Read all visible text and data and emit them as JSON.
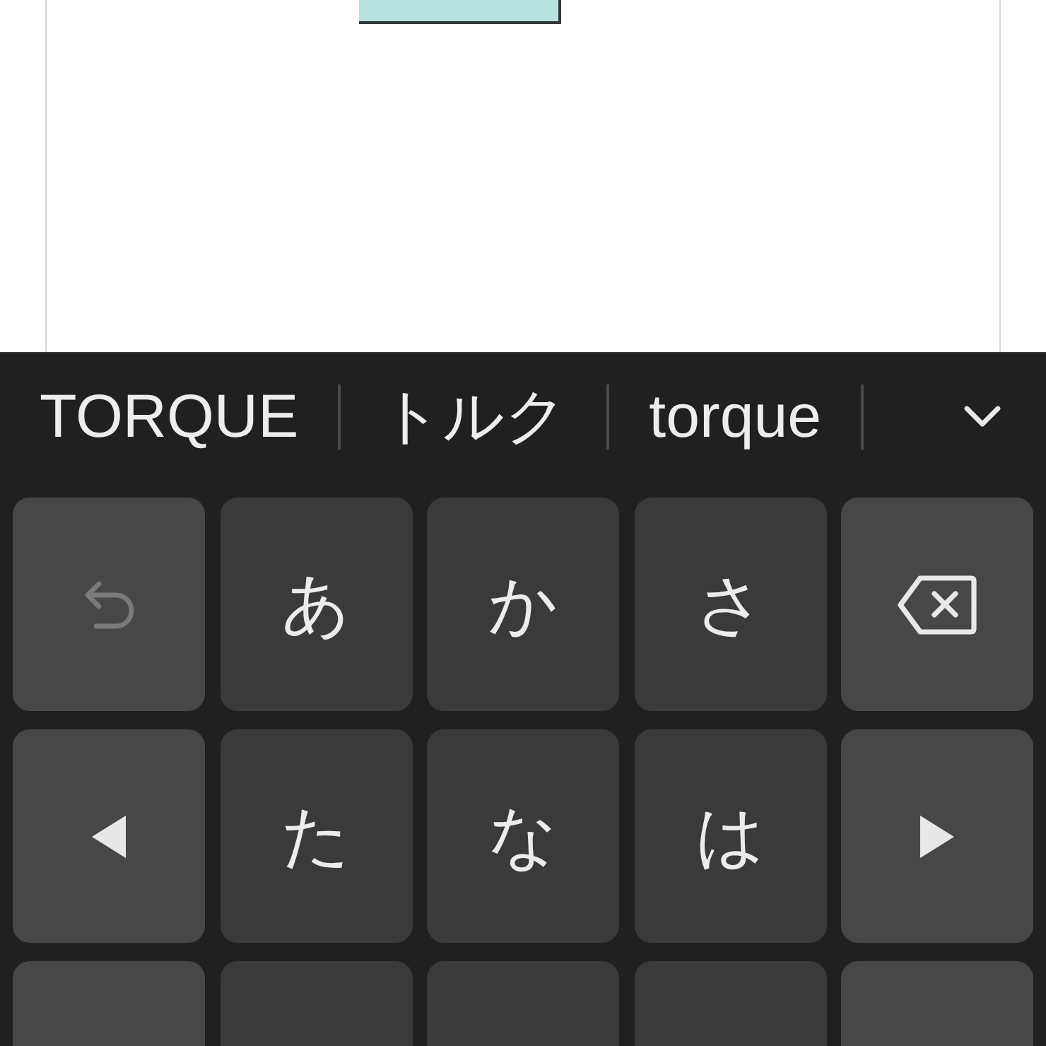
{
  "editor": {
    "composing_highlight": true
  },
  "suggestions": [
    {
      "text": "TORQUE"
    },
    {
      "text": "トルク"
    },
    {
      "text": "torque"
    }
  ],
  "keyboard": {
    "rows": [
      {
        "keys": [
          {
            "kind": "undo",
            "disabled": true
          },
          {
            "kind": "char",
            "label": "あ",
            "disabled": false
          },
          {
            "kind": "char",
            "label": "か",
            "disabled": false
          },
          {
            "kind": "char",
            "label": "さ",
            "disabled": false
          },
          {
            "kind": "backspace",
            "disabled": false
          }
        ]
      },
      {
        "keys": [
          {
            "kind": "left",
            "disabled": false
          },
          {
            "kind": "char",
            "label": "た",
            "disabled": false
          },
          {
            "kind": "char",
            "label": "な",
            "disabled": false
          },
          {
            "kind": "char",
            "label": "は",
            "disabled": false
          },
          {
            "kind": "right",
            "disabled": false
          }
        ]
      },
      {
        "keys": [
          {
            "kind": "function"
          },
          {
            "kind": "char"
          },
          {
            "kind": "char"
          },
          {
            "kind": "char"
          },
          {
            "kind": "function"
          }
        ]
      }
    ]
  }
}
